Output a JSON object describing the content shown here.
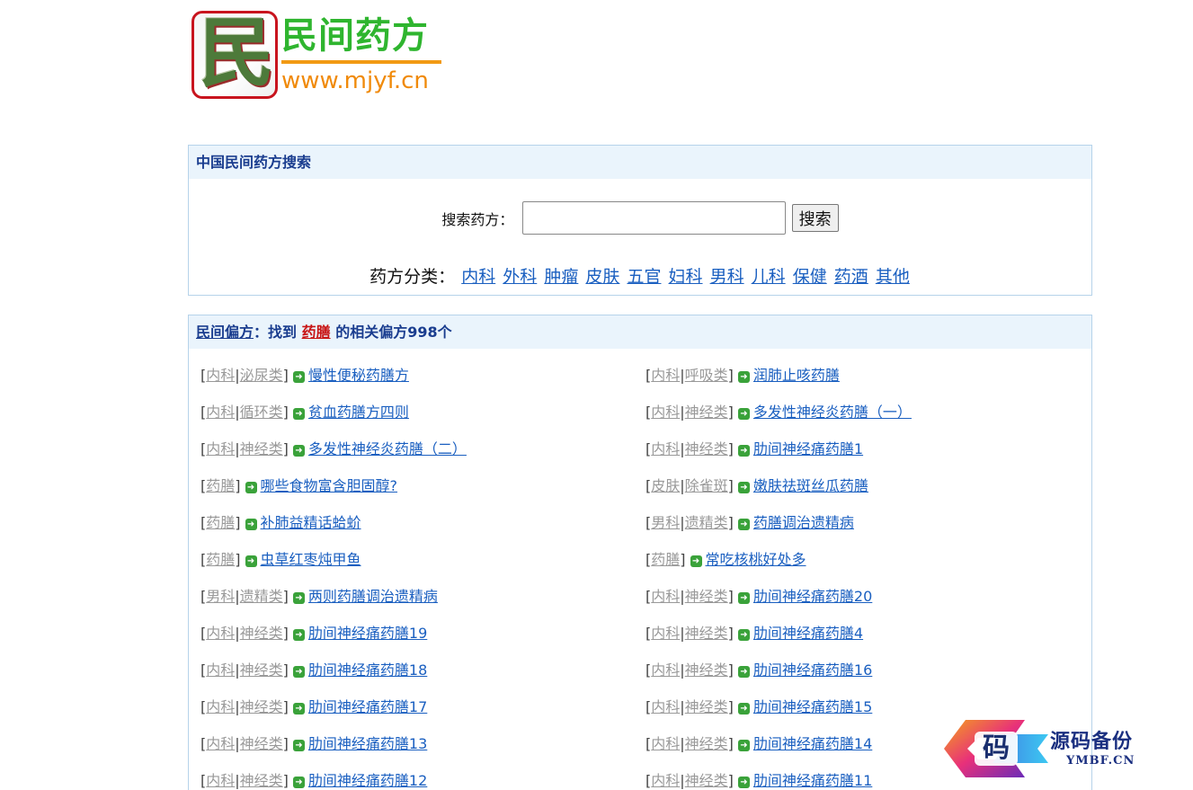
{
  "logo": {
    "badge_char": "民",
    "title": "民间药方",
    "url": "www.mjyf.cn"
  },
  "search": {
    "header": "中国民间药方搜索",
    "label": "搜索药方：",
    "input_value": "",
    "button_label": "搜索",
    "categories_label": "药方分类：",
    "categories": [
      "内科",
      "外科",
      "肿瘤",
      "皮肤",
      "五官",
      "妇科",
      "男科",
      "儿科",
      "保健",
      "药酒",
      "其他"
    ]
  },
  "results": {
    "header_link": "民间偏方",
    "header_colon": "：找到",
    "keyword": "药膳",
    "count_text": "的相关偏方998个",
    "items": [
      {
        "tags": [
          "内科",
          "泌尿类"
        ],
        "title": "慢性便秘药膳方"
      },
      {
        "tags": [
          "内科",
          "呼吸类"
        ],
        "title": "润肺止咳药膳"
      },
      {
        "tags": [
          "内科",
          "循环类"
        ],
        "title": "贫血药膳方四则"
      },
      {
        "tags": [
          "内科",
          "神经类"
        ],
        "title": "多发性神经炎药膳（一）"
      },
      {
        "tags": [
          "内科",
          "神经类"
        ],
        "title": "多发性神经炎药膳（二）"
      },
      {
        "tags": [
          "内科",
          "神经类"
        ],
        "title": "肋间神经痛药膳1"
      },
      {
        "tags": [
          "药膳"
        ],
        "title": "哪些食物富含胆固醇?"
      },
      {
        "tags": [
          "皮肤",
          "除雀斑"
        ],
        "title": "嫩肤祛斑丝瓜药膳"
      },
      {
        "tags": [
          "药膳"
        ],
        "title": "补肺益精话蛤蚧"
      },
      {
        "tags": [
          "男科",
          "遗精类"
        ],
        "title": "药膳调治遗精病"
      },
      {
        "tags": [
          "药膳"
        ],
        "title": "虫草红枣炖甲鱼"
      },
      {
        "tags": [
          "药膳"
        ],
        "title": "常吃核桃好处多"
      },
      {
        "tags": [
          "男科",
          "遗精类"
        ],
        "title": "两则药膳调治遗精病"
      },
      {
        "tags": [
          "内科",
          "神经类"
        ],
        "title": "肋间神经痛药膳20"
      },
      {
        "tags": [
          "内科",
          "神经类"
        ],
        "title": "肋间神经痛药膳19"
      },
      {
        "tags": [
          "内科",
          "神经类"
        ],
        "title": "肋间神经痛药膳4"
      },
      {
        "tags": [
          "内科",
          "神经类"
        ],
        "title": "肋间神经痛药膳18"
      },
      {
        "tags": [
          "内科",
          "神经类"
        ],
        "title": "肋间神经痛药膳16"
      },
      {
        "tags": [
          "内科",
          "神经类"
        ],
        "title": "肋间神经痛药膳17"
      },
      {
        "tags": [
          "内科",
          "神经类"
        ],
        "title": "肋间神经痛药膳15"
      },
      {
        "tags": [
          "内科",
          "神经类"
        ],
        "title": "肋间神经痛药膳13"
      },
      {
        "tags": [
          "内科",
          "神经类"
        ],
        "title": "肋间神经痛药膳14"
      },
      {
        "tags": [
          "内科",
          "神经类"
        ],
        "title": "肋间神经痛药膳12"
      },
      {
        "tags": [
          "内科",
          "神经类"
        ],
        "title": "肋间神经痛药膳11"
      }
    ]
  },
  "watermark": {
    "char": "码",
    "title": "源码备份",
    "subtitle": "YMBF.CN"
  },
  "colors": {
    "link": "#1a5fc0",
    "keyword": "#c81414",
    "header_bg": "#eaf4fc",
    "border": "#b6d3ea",
    "arrow": "#3aa23a"
  }
}
